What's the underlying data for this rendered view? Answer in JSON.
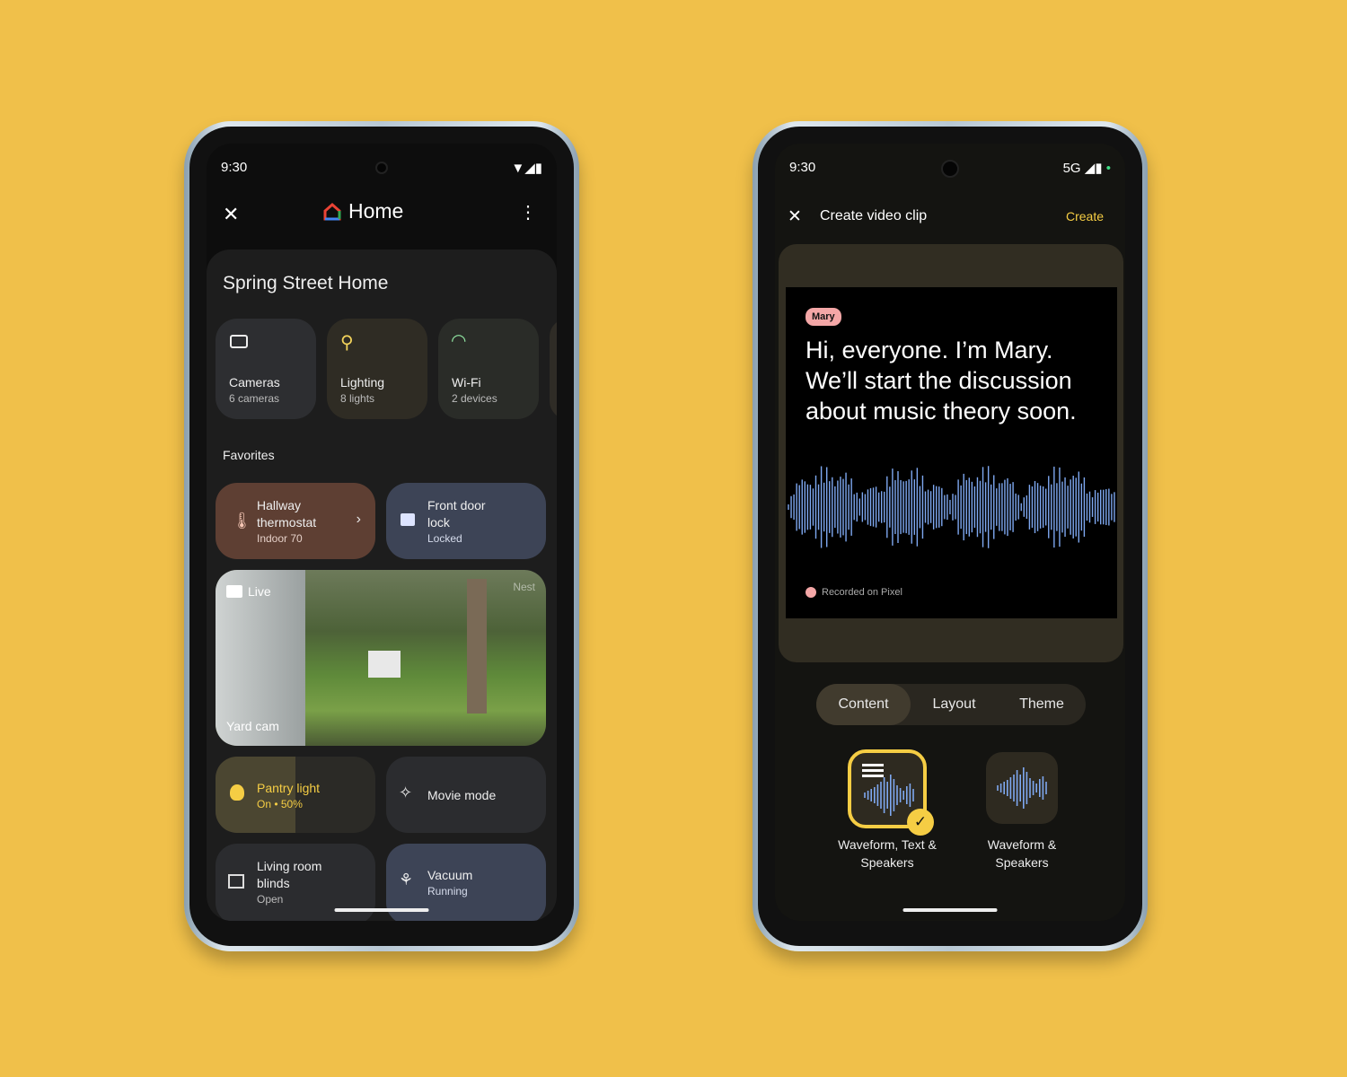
{
  "left_phone": {
    "status": {
      "time": "9:30"
    },
    "header": {
      "title": "Home"
    },
    "home_name": "Spring Street Home",
    "categories": [
      {
        "label": "Cameras",
        "sub": "6 cameras",
        "icon": "camera-icon"
      },
      {
        "label": "Lighting",
        "sub": "8 lights",
        "icon": "lamp-icon"
      },
      {
        "label": "Wi-Fi",
        "sub": "2 devices",
        "icon": "wifi-icon"
      }
    ],
    "favorites_label": "Favorites",
    "thermostat": {
      "line1": "Hallway",
      "line2": "thermostat",
      "sub": "Indoor 70"
    },
    "lock": {
      "line1": "Front door",
      "line2": "lock",
      "sub": "Locked"
    },
    "camera": {
      "live": "Live",
      "name": "Yard cam",
      "watermark": "Nest"
    },
    "pantry": {
      "label": "Pantry light",
      "sub": "On • 50%",
      "level_percent": 50
    },
    "movie": {
      "label": "Movie mode"
    },
    "blinds": {
      "line1": "Living room",
      "line2": "blinds",
      "sub": "Open"
    },
    "vacuum": {
      "label": "Vacuum",
      "sub": "Running"
    }
  },
  "right_phone": {
    "status": {
      "time": "9:30",
      "network": "5G"
    },
    "header": {
      "title": "Create video clip",
      "action": "Create"
    },
    "preview": {
      "speaker": "Mary",
      "transcript": "Hi, everyone. I’m Mary. We’ll start the discussion about music theory soon.",
      "footer": "Recorded on Pixel"
    },
    "tabs": [
      {
        "label": "Content",
        "selected": true
      },
      {
        "label": "Layout"
      },
      {
        "label": "Theme"
      }
    ],
    "options": [
      {
        "label": "Waveform, Text & Speakers",
        "selected": true
      },
      {
        "label": "Waveform & Speakers"
      }
    ]
  },
  "colors": {
    "background": "#f0c04a",
    "accent": "#f5cd44",
    "waveform": "#7ea8f0",
    "speaker_chip": "#f4a7a7"
  }
}
